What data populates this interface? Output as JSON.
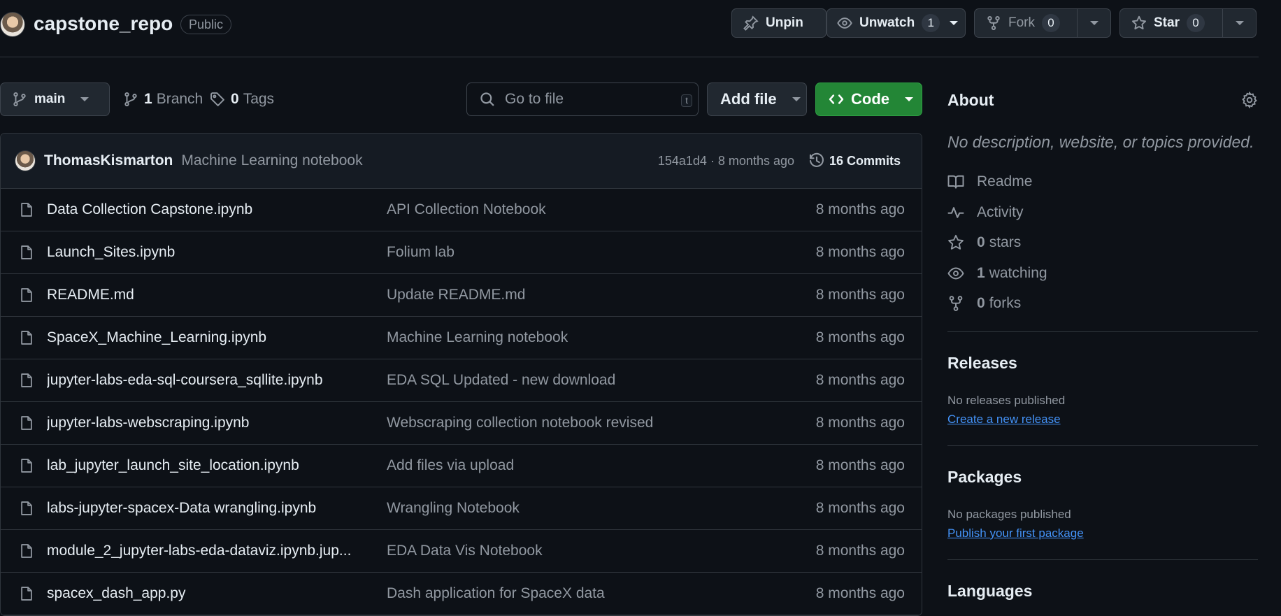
{
  "header": {
    "repo_name": "capstone_repo",
    "visibility": "Public",
    "unpin_label": "Unpin",
    "unwatch_label": "Unwatch",
    "watch_count": "1",
    "fork_label": "Fork",
    "fork_count": "0",
    "star_label": "Star",
    "star_count": "0"
  },
  "toolbar": {
    "branch": "main",
    "branch_count": "1",
    "branch_label": "Branch",
    "tag_count": "0",
    "tag_label": "Tags",
    "search_placeholder": "Go to file",
    "search_shortcut": "t",
    "add_file_label": "Add file",
    "code_label": "Code"
  },
  "commit": {
    "author": "ThomasKismarton",
    "message": "Machine Learning notebook",
    "meta": "154a1d4 · 8 months ago",
    "commits_label": "16 Commits"
  },
  "files": [
    {
      "name": "Data Collection Capstone.ipynb",
      "message": "API Collection Notebook",
      "date": "8 months ago"
    },
    {
      "name": "Launch_Sites.ipynb",
      "message": "Folium lab",
      "date": "8 months ago"
    },
    {
      "name": "README.md",
      "message": "Update README.md",
      "date": "8 months ago"
    },
    {
      "name": "SpaceX_Machine_Learning.ipynb",
      "message": "Machine Learning notebook",
      "date": "8 months ago"
    },
    {
      "name": "jupyter-labs-eda-sql-coursera_sqllite.ipynb",
      "message": "EDA SQL Updated - new download",
      "date": "8 months ago"
    },
    {
      "name": "jupyter-labs-webscraping.ipynb",
      "message": "Webscraping collection notebook revised",
      "date": "8 months ago"
    },
    {
      "name": "lab_jupyter_launch_site_location.ipynb",
      "message": "Add files via upload",
      "date": "8 months ago"
    },
    {
      "name": "labs-jupyter-spacex-Data wrangling.ipynb",
      "message": "Wrangling Notebook",
      "date": "8 months ago"
    },
    {
      "name": "module_2_jupyter-labs-eda-dataviz.ipynb.jup...",
      "message": "EDA Data Vis Notebook",
      "date": "8 months ago"
    },
    {
      "name": "spacex_dash_app.py",
      "message": "Dash application for SpaceX data",
      "date": "8 months ago"
    }
  ],
  "about": {
    "title": "About",
    "description": "No description, website, or topics provided.",
    "readme": "Readme",
    "activity": "Activity",
    "stars_count": "0",
    "stars_label": "stars",
    "watching_count": "1",
    "watching_label": "watching",
    "forks_count": "0",
    "forks_label": "forks"
  },
  "releases": {
    "title": "Releases",
    "note": "No releases published",
    "link": "Create a new release"
  },
  "packages": {
    "title": "Packages",
    "note": "No packages published",
    "link": "Publish your first package"
  },
  "languages": {
    "title": "Languages"
  },
  "colors": {
    "background": "#0d1117",
    "accent_green": "#238636",
    "link_blue": "#4493f8",
    "border": "#30363d"
  }
}
